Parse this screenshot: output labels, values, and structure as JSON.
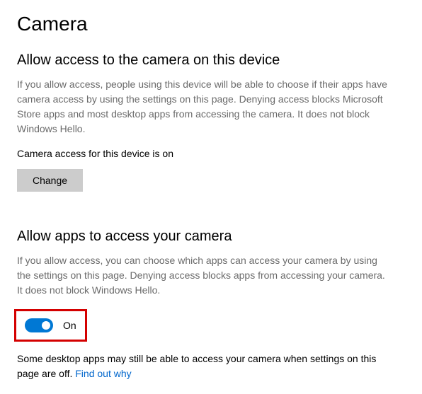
{
  "page": {
    "title": "Camera"
  },
  "section1": {
    "heading": "Allow access to the camera on this device",
    "description": "If you allow access, people using this device will be able to choose if their apps have camera access by using the settings on this page. Denying access blocks Microsoft Store apps and most desktop apps from accessing the camera. It does not block Windows Hello.",
    "status": "Camera access for this device is on",
    "change_button": "Change"
  },
  "section2": {
    "heading": "Allow apps to access your camera",
    "description": "If you allow access, you can choose which apps can access your camera by using the settings on this page. Denying access blocks apps from accessing your camera. It does not block Windows Hello.",
    "toggle_state": "On",
    "footer_text": "Some desktop apps may still be able to access your camera when settings on this page are off. ",
    "footer_link": "Find out why"
  }
}
